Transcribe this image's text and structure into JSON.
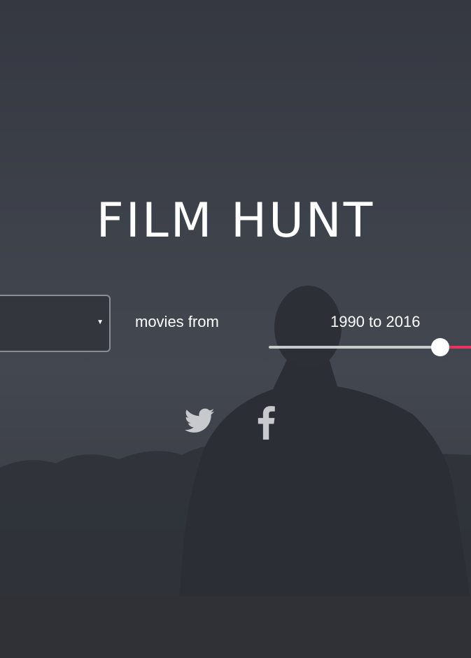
{
  "brand": {
    "logo_text": "FILM HUNT"
  },
  "search": {
    "genre_value": "",
    "movies_from_label": "movies from",
    "year_range_label": "1990 to 2016",
    "year_from": 1990,
    "year_to": 2016
  },
  "social": {
    "icons": [
      "twitter-icon",
      "facebook-icon"
    ]
  },
  "colors": {
    "background": "#3b3f47",
    "accent": "#e8345c",
    "footer": "#2f3137"
  }
}
